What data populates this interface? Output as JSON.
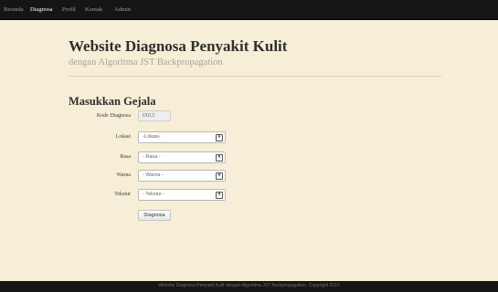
{
  "nav": {
    "items": [
      {
        "label": "Beranda",
        "active": false
      },
      {
        "label": "Diagnosa",
        "active": true
      },
      {
        "label": "Profil",
        "active": false
      },
      {
        "label": "Kontak",
        "active": false
      },
      {
        "label": "Admin",
        "active": false
      }
    ]
  },
  "header": {
    "title": "Website Diagnosa Penyakit Kulit",
    "subtitle": "dengan Algoritma JST Backpropagation"
  },
  "form": {
    "title": "Masukkan Gejala",
    "code_label": "Kode Diagnosa",
    "code_value": "D013",
    "fields": [
      {
        "label": "Lokasi",
        "selected": "-Lokasi-"
      },
      {
        "label": "Rasa",
        "selected": "- Rasa -"
      },
      {
        "label": "Warna",
        "selected": "- Warna -"
      },
      {
        "label": "Tekstur",
        "selected": "- Tekstur -"
      }
    ],
    "submit_label": "Diagnosa"
  },
  "footer": {
    "text": "Website Diagnosa Penyakit Kulit dengan Algoritma JST Backpropagation. Copyright 2013"
  },
  "colors": {
    "background": "#f6eed6",
    "navbar": "#151515",
    "heading": "#2f2f2f",
    "subtitle": "#a9a49a"
  }
}
